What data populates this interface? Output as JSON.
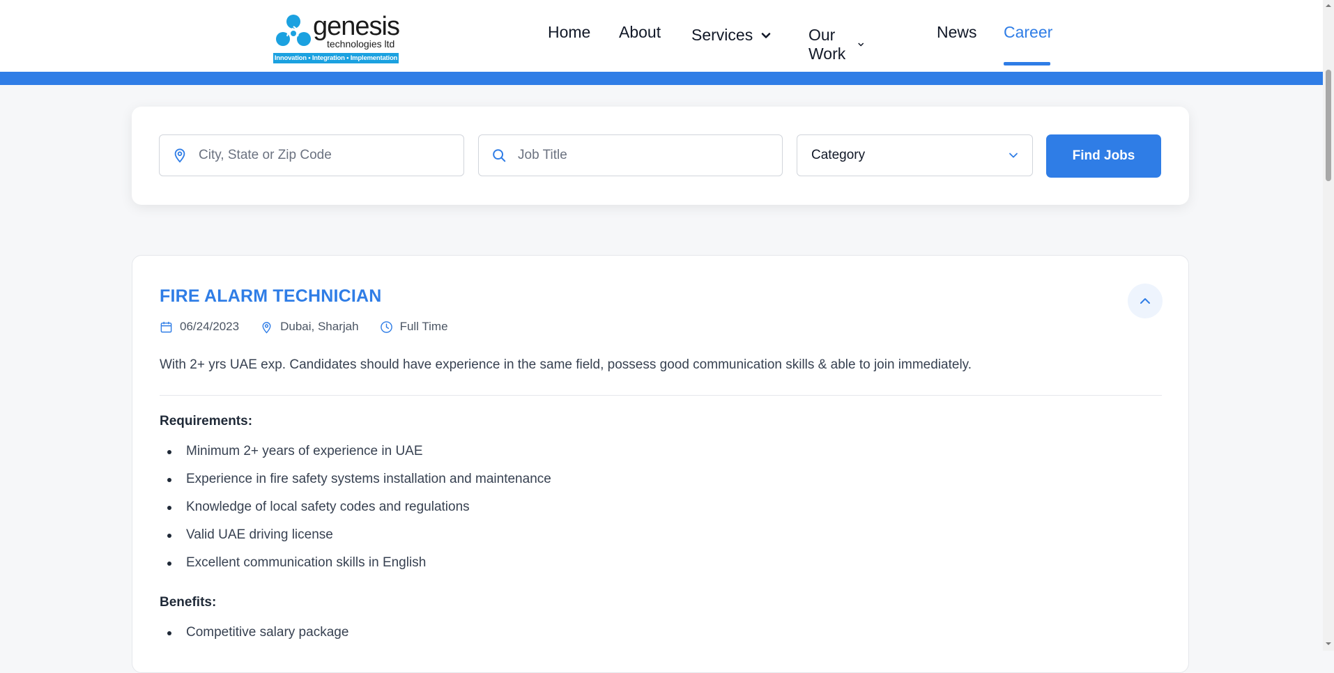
{
  "brand": {
    "name": "genesis",
    "subtitle": "technologies ltd",
    "tagline": "Innovation • Integration • Implementation",
    "colors": {
      "primary": "#2f7de6",
      "logo_blue": "#1ba1e0"
    }
  },
  "nav": {
    "items": [
      {
        "label": "Home"
      },
      {
        "label": "About"
      },
      {
        "label": "Services",
        "icon": "chevron-down-icon"
      },
      {
        "label": "Our Work",
        "icon": "chevron-down-icon"
      },
      {
        "label": "News"
      },
      {
        "label": "Career",
        "active": true
      }
    ]
  },
  "search": {
    "location_placeholder": "City, State or Zip Code",
    "location_icon": "map-pin-icon",
    "title_placeholder": "Job Title",
    "title_icon": "search-icon",
    "category_selected": "Category",
    "category_icon": "chevron-down-icon",
    "button_label": "Find Jobs"
  },
  "job": {
    "title": "FIRE ALARM TECHNICIAN",
    "date": "06/24/2023",
    "location": "Dubai, Sharjah",
    "type": "Full Time",
    "icons": {
      "date": "calendar-icon",
      "location": "map-pin-icon",
      "type": "clock-icon",
      "toggle": "chevron-up-icon"
    },
    "description": "With 2+ yrs UAE exp. Candidates should have experience in the same field, possess good communication skills & able to join immediately.",
    "requirements_heading": "Requirements:",
    "requirements": [
      "Minimum 2+ years of experience in UAE",
      "Experience in fire safety systems installation and maintenance",
      "Knowledge of local safety codes and regulations",
      "Valid UAE driving license",
      "Excellent communication skills in English"
    ],
    "benefits_heading": "Benefits:",
    "benefits": [
      "Competitive salary package"
    ]
  }
}
